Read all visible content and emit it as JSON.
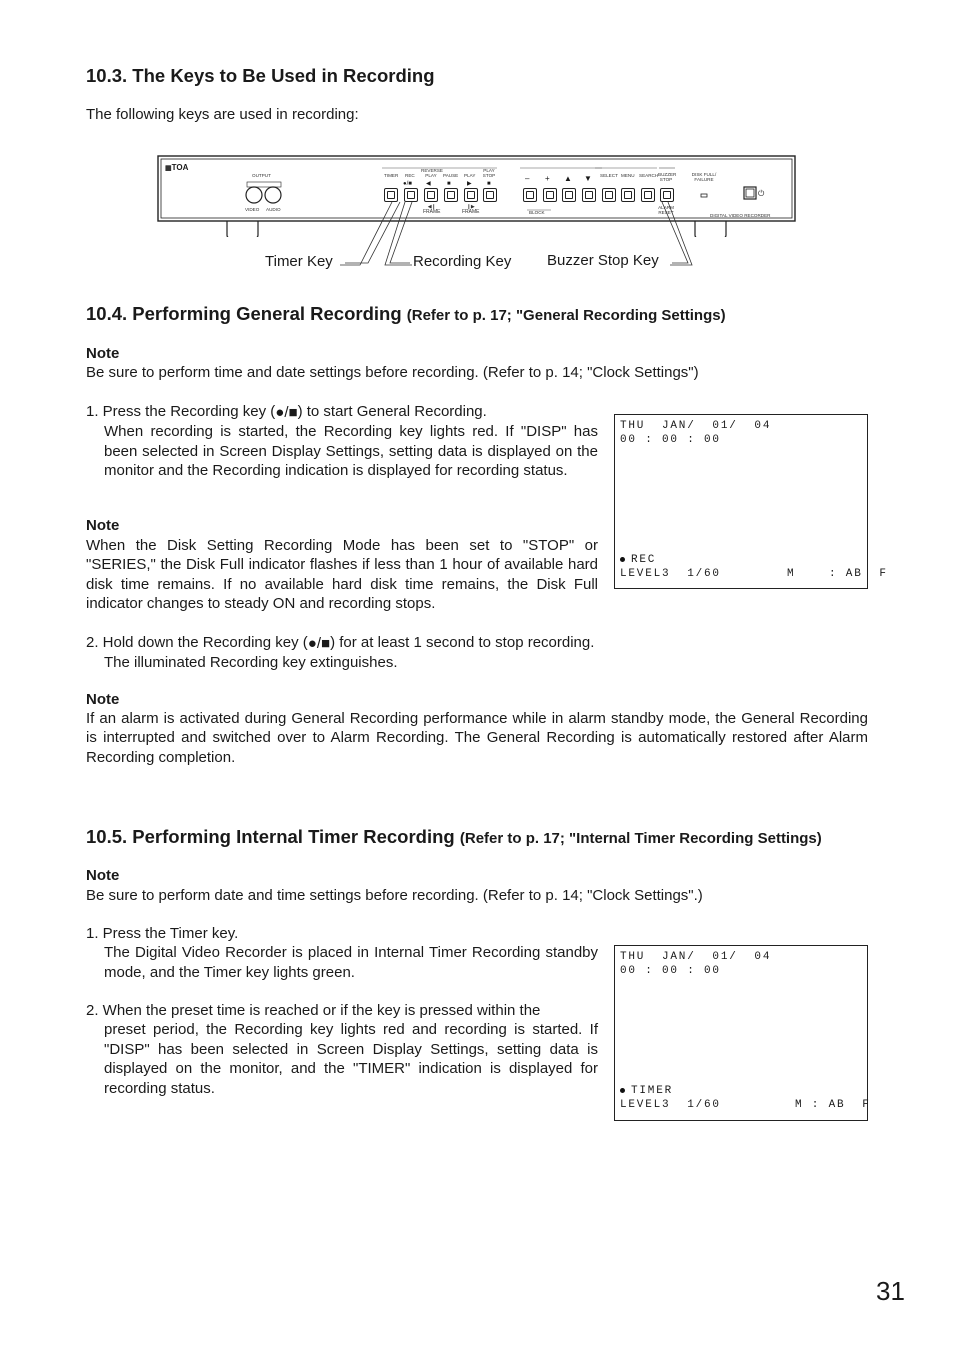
{
  "sections": {
    "keys": {
      "heading": "10.3. The Keys to Be Used in Recording",
      "intro": "The following keys are used in recording:",
      "device": {
        "brand": "TOA",
        "output_label": "OUTPUT",
        "video_label": "VIDEO",
        "audio_label": "AUDIO",
        "key_labels": {
          "timer": "TIMER",
          "rec": "REC",
          "reverse_play": "REVERSE PLAY",
          "pause": "PAUSE",
          "play": "PLAY",
          "play_stop": "PLAY STOP",
          "frame_back": "FRAME",
          "frame_fwd": "FRAME",
          "minus": "–",
          "plus": "+",
          "up": "▲",
          "down": "▼",
          "block": "BLOCK",
          "select": "SELECT",
          "menu": "MENU",
          "search": "SEARCH",
          "buzzer_stop": "BUZZER STOP",
          "alarm_reset": "ALARM RESET",
          "disk_full_failure": "DISK FULL/ FAILURE",
          "model": "DIGITAL  VIDEO  RECORDER"
        }
      },
      "callouts": {
        "timer_key": "Timer Key",
        "recording_key": "Recording Key",
        "buzzer_stop_key": "Buzzer Stop Key"
      }
    },
    "general": {
      "heading": "10.4. Performing General Recording",
      "heading_ref": "(Refer to p. 17; \"General Recording Settings)",
      "note1_title": "Note",
      "note1_text": "Be sure to perform time and date settings before recording. (Refer to p. 14; \"Clock Settings\")",
      "step1_prefix": "1. Press the Recording key (",
      "step1_suffix": ") to start General Recording.",
      "step1_body": "When recording is started, the Recording key lights red. If \"DISP\" has been selected in Screen Display Settings, setting data is displayed on the monitor and the Recording indication is displayed for recording status.",
      "note2_title": "Note",
      "note2_text": "When the Disk Setting Recording Mode has been set to \"STOP\" or \"SERIES,\" the Disk Full indicator flashes if less than 1 hour of available hard disk time remains. If no available hard disk time remains, the Disk Full indicator changes to steady ON and recording stops.",
      "step2_prefix": "2. Hold down the Recording key (",
      "step2_suffix": ") for at least 1 second to stop recording.",
      "step2_body": "The illuminated Recording key extinguishes.",
      "note3_title": "Note",
      "note3_text": "If an alarm is activated during General Recording performance while in alarm standby mode, the General Recording is interrupted and switched over to Alarm Recording. The General Recording is automatically restored after Alarm Recording completion.",
      "screen": {
        "line1": "THU  JAN/  01/  04",
        "line2": "00 : 00 : 00",
        "status": "REC",
        "level": "LEVEL3  1/60",
        "mode": "M    : AB  F"
      }
    },
    "timer": {
      "heading": "10.5. Performing Internal Timer Recording",
      "heading_ref": "(Refer to p. 17; \"Internal Timer Recording Settings)",
      "note_title": "Note",
      "note_text": "Be sure to perform date and time settings before recording. (Refer to p. 14; \"Clock Settings\".)",
      "step1_title": "1. Press the Timer key.",
      "step1_body": "The Digital Video Recorder is placed in Internal Timer Recording standby mode, and the Timer key lights green.",
      "step2_first": "2. When the preset time is reached or if the key is pressed within the",
      "step2_body": "preset period, the Recording key lights red and recording is started. If \"DISP\" has been selected in Screen Display Settings, setting data is displayed on the monitor, and the \"TIMER\" indication is displayed for recording status.",
      "screen": {
        "line1": "THU  JAN/  01/  04",
        "line2": "00 : 00 : 00",
        "status": "TIMER",
        "level": "LEVEL3  1/60",
        "mode": "M : AB  F"
      }
    }
  },
  "page_number": "31"
}
